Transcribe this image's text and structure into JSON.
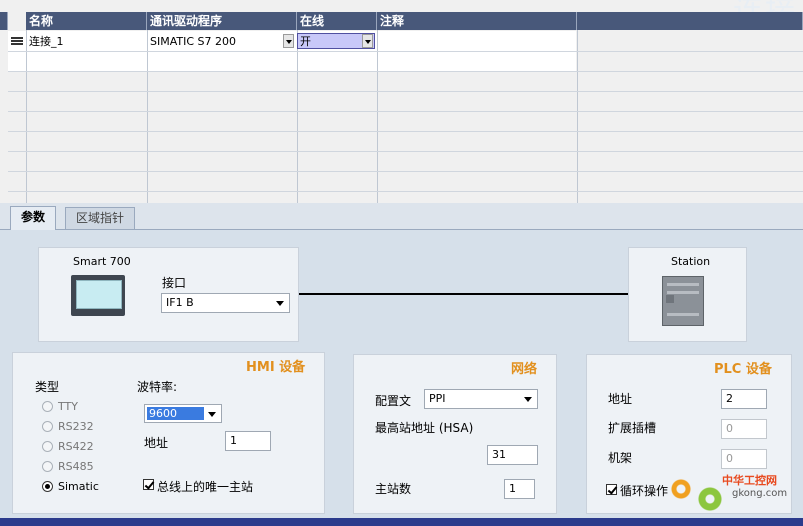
{
  "window": {
    "title_fragment": "连接"
  },
  "table": {
    "columns": [
      {
        "label": "名称"
      },
      {
        "label": "通讯驱动程序"
      },
      {
        "label": "在线"
      },
      {
        "label": "注释"
      }
    ],
    "rows": [
      {
        "name": "连接_1",
        "driver": "SIMATIC S7 200",
        "online": "开",
        "comment": ""
      }
    ]
  },
  "tabs": [
    {
      "label": "参数",
      "active": true
    },
    {
      "label": "区域指针",
      "active": false
    }
  ],
  "diagram": {
    "hmi_device": "Smart 700",
    "interface_label": "接口",
    "interface_value": "IF1 B",
    "plc_station": "Station"
  },
  "hmi_panel": {
    "title": "HMI 设备",
    "type_label": "类型",
    "types": [
      {
        "label": "TTY",
        "selected": false
      },
      {
        "label": "RS232",
        "selected": false
      },
      {
        "label": "RS422",
        "selected": false
      },
      {
        "label": "RS485",
        "selected": false
      },
      {
        "label": "Simatic",
        "selected": true
      }
    ],
    "baud_label": "波特率:",
    "baud_value": "9600",
    "address_label": "地址",
    "address_value": "1",
    "only_master_label": "总线上的唯一主站"
  },
  "network_panel": {
    "title": "网络",
    "profile_label": "配置文",
    "profile_value": "PPI",
    "hsa_label": "最高站地址 (HSA)",
    "hsa_value": "31",
    "masters_label": "主站数",
    "masters_value": "1"
  },
  "plc_panel": {
    "title": "PLC 设备",
    "address_label": "地址",
    "address_value": "2",
    "slot_label": "扩展插槽",
    "slot_value": "0",
    "rack_label": "机架",
    "rack_value": "0",
    "cyclic_label": "循环操作"
  },
  "watermark": {
    "brand": "中华工控网",
    "url": "gkong.com"
  },
  "colors": {
    "header_bg": "#48587a",
    "panel_title": "#e2901e",
    "selected_blue": "#3a7be0",
    "online_cell": "#c8c8f8"
  }
}
